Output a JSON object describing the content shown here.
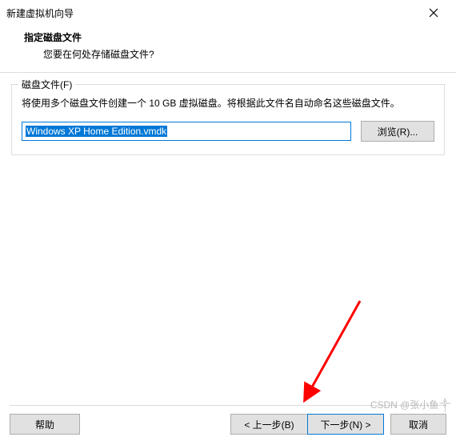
{
  "window": {
    "title": "新建虚拟机向导"
  },
  "header": {
    "title": "指定磁盘文件",
    "subtitle": "您要在何处存储磁盘文件?"
  },
  "group": {
    "title": "磁盘文件(F)",
    "description": "将使用多个磁盘文件创建一个 10 GB 虚拟磁盘。将根据此文件名自动命名这些磁盘文件。",
    "file_value": "Windows XP Home Edition.vmdk",
    "browse_label": "浏览(R)..."
  },
  "footer": {
    "help_label": "帮助",
    "back_label": "< 上一步(B)",
    "next_label": "下一步(N) >",
    "cancel_label": "取消"
  },
  "watermark": "CSDN @张小鱼༒"
}
